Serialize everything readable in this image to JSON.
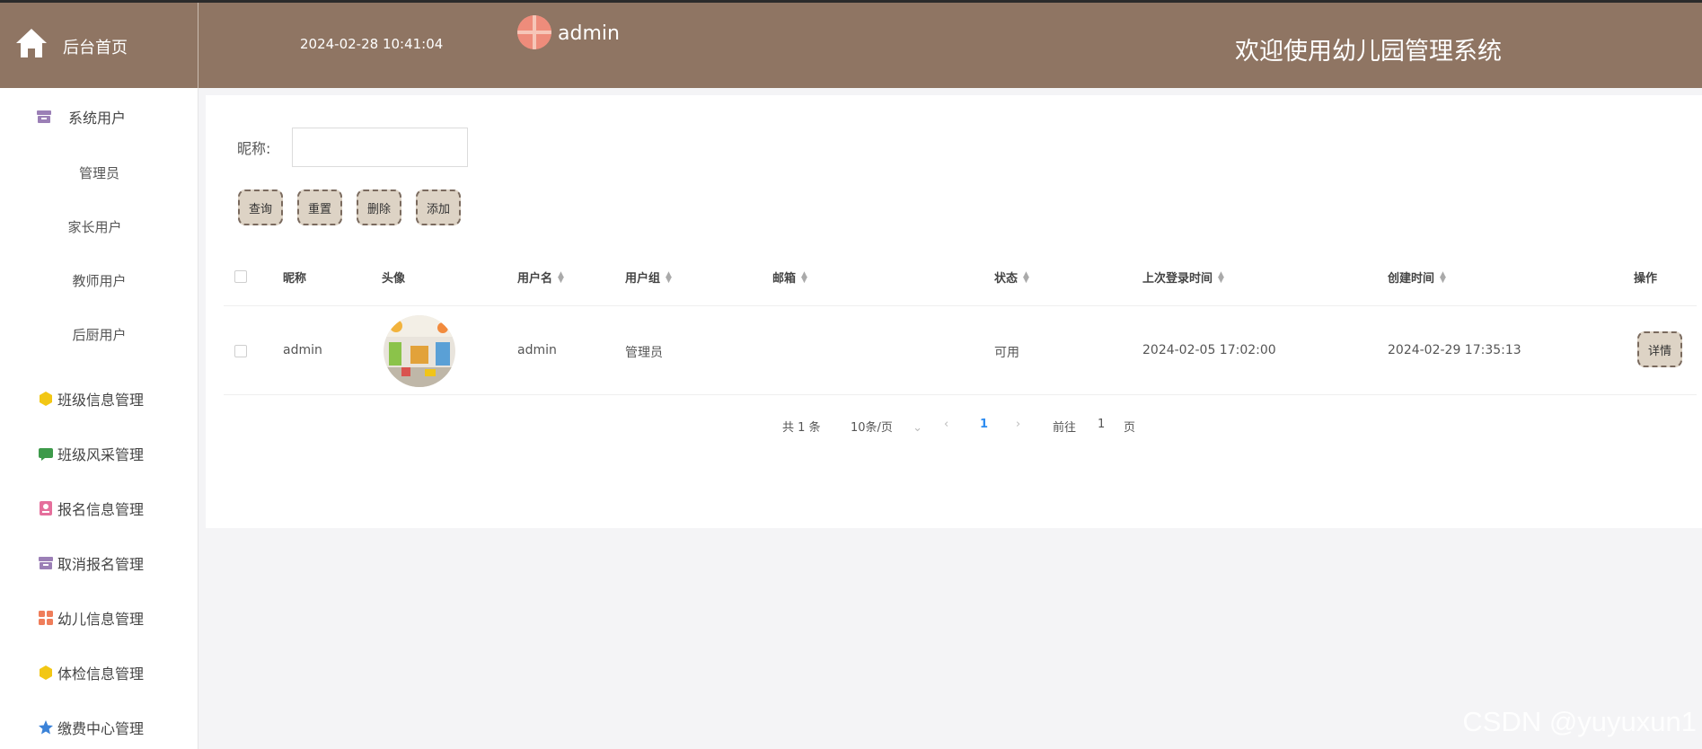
{
  "header": {
    "home_label": "后台首页",
    "datetime": "2024-02-28 10:41:04",
    "admin_name": "admin",
    "welcome": "欢迎使用幼儿园管理系统",
    "bg_color": "#8f7563"
  },
  "sidebar": {
    "group_users": {
      "label": "系统用户",
      "icon": "archive-icon",
      "color": "#9b7fb6"
    },
    "sub_items": [
      "管理员",
      "家长用户",
      "教师用户",
      "后厨用户"
    ],
    "items": [
      {
        "label": "班级信息管理",
        "icon": "cube-icon",
        "color": "#f2c714"
      },
      {
        "label": "班级风采管理",
        "icon": "chat-icon",
        "color": "#3d9a4a"
      },
      {
        "label": "报名信息管理",
        "icon": "badge-icon",
        "color": "#e56f9c"
      },
      {
        "label": "取消报名管理",
        "icon": "archive-icon",
        "color": "#9b7fb6"
      },
      {
        "label": "幼儿信息管理",
        "icon": "grid-icon",
        "color": "#ef7d5a"
      },
      {
        "label": "体检信息管理",
        "icon": "cube-icon",
        "color": "#f2c714"
      },
      {
        "label": "缴费中心管理",
        "icon": "star-icon",
        "color": "#3b82d8"
      }
    ]
  },
  "search": {
    "label": "昵称:",
    "value": "",
    "placeholder": ""
  },
  "buttons": {
    "query": "查询",
    "reset": "重置",
    "delete": "删除",
    "add": "添加"
  },
  "table": {
    "headers": {
      "nickname": "昵称",
      "avatar": "头像",
      "username": "用户名",
      "group": "用户组",
      "email": "邮箱",
      "status": "状态",
      "last_login": "上次登录时间",
      "created": "创建时间",
      "actions": "操作"
    },
    "rows": [
      {
        "nickname": "admin",
        "username": "admin",
        "group": "管理员",
        "email": "",
        "status": "可用",
        "last_login": "2024-02-05 17:02:00",
        "created": "2024-02-29 17:35:13",
        "detail": "详情"
      }
    ]
  },
  "pagination": {
    "total": "共 1 条",
    "page_size": "10条/页",
    "current_page": "1",
    "goto_label": "前往",
    "goto_value": "1",
    "page_suffix": "页"
  },
  "watermark": "CSDN @yuyuxun1"
}
